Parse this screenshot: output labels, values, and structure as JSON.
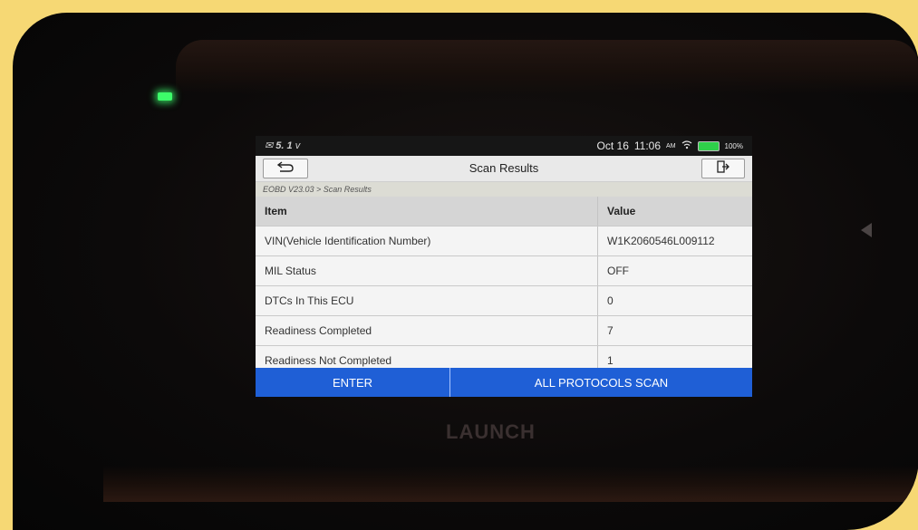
{
  "device": {
    "brand": "LAUNCH"
  },
  "status": {
    "left_text": "✉ ́ ̄",
    "date": "Oct 16",
    "time": "11:06",
    "ampm": "AM",
    "battery": "100%",
    "wifi_icon": "wifi-icon",
    "battery_icon": "battery-icon"
  },
  "header": {
    "title": "Scan Results",
    "back_icon": "back-arrow-icon",
    "exit_icon": "exit-icon"
  },
  "breadcrumb": "EOBD V23.03 > Scan Results",
  "table": {
    "columns": [
      "Item",
      "Value"
    ],
    "rows": [
      {
        "item": "VIN(Vehicle Identification Number)",
        "value": "W1K2060546L009112"
      },
      {
        "item": "MIL Status",
        "value": "OFF"
      },
      {
        "item": "DTCs In This ECU",
        "value": "0"
      },
      {
        "item": "Readiness Completed",
        "value": "7"
      },
      {
        "item": "Readiness Not Completed",
        "value": "1"
      }
    ]
  },
  "footer": {
    "enter_label": "ENTER",
    "scan_label": "ALL PROTOCOLS SCAN"
  },
  "colors": {
    "accent_blue": "#1f5fd6",
    "frame_yellow": "#f6d874",
    "led_green": "#3dfc6a"
  }
}
